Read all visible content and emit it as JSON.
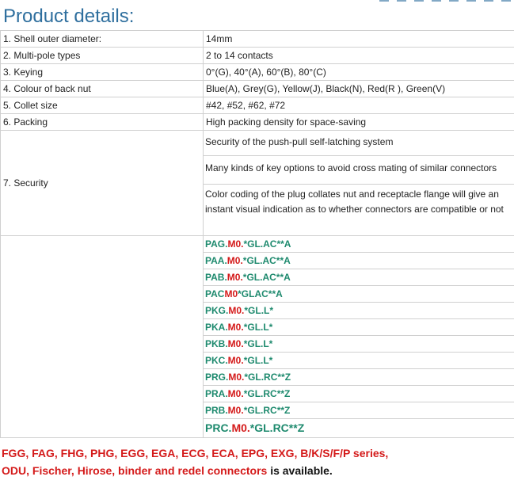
{
  "heading": "Product details:",
  "specs": [
    {
      "label": "1. Shell outer diameter:",
      "value": "14mm"
    },
    {
      "label": "2. Multi-pole types",
      "value": "2 to 14 contacts"
    },
    {
      "label": "3. Keying",
      "value": "0°(G), 40°(A), 60°(B), 80°(C)"
    },
    {
      "label": "4. Colour of back nut",
      "value": "Blue(A), Grey(G), Yellow(J), Black(N), Red(R ), Green(V)"
    },
    {
      "label": "5. Collet size",
      "value": "#42, #52, #62, #72"
    },
    {
      "label": "6. Packing",
      "value": "High packing density for space-saving"
    }
  ],
  "security": {
    "label": "7. Security",
    "items": [
      "Security of the push-pull self-latching system",
      "Many kinds of key options to avoid cross mating of similar connectors",
      "Color coding of the plug collates nut and receptacle flange will give an instant visual indication as to whether connectors are compatible or not"
    ]
  },
  "models": [
    {
      "prefix": "PAG.",
      "mid": "M0.",
      "suffix": "*GL.AC**A"
    },
    {
      "prefix": "PAA.",
      "mid": "M0.",
      "suffix": "*GL.AC**A"
    },
    {
      "prefix": "PAB.",
      "mid": "M0.",
      "suffix": "*GL.AC**A"
    },
    {
      "prefix": "PAC",
      "mid": "M0",
      "suffix": "*GLAC**A"
    },
    {
      "prefix": "PKG.",
      "mid": "M0.",
      "suffix": "*GL.L*"
    },
    {
      "prefix": "PKA.",
      "mid": "M0.",
      "suffix": "*GL.L*"
    },
    {
      "prefix": "PKB.",
      "mid": "M0.",
      "suffix": "*GL.L*"
    },
    {
      "prefix": "PKC.",
      "mid": "M0.",
      "suffix": "*GL.L*"
    },
    {
      "prefix": "PRG.",
      "mid": "M0.",
      "suffix": "*GL.RC**Z"
    },
    {
      "prefix": "PRA.",
      "mid": "M0.",
      "suffix": "*GL.RC**Z"
    },
    {
      "prefix": "PRB.",
      "mid": "M0.",
      "suffix": "*GL.RC**Z"
    },
    {
      "prefix": "PRC.",
      "mid": "M0.",
      "suffix": "*GL.RC**Z"
    }
  ],
  "footer": {
    "line1": "FGG, FAG, FHG, PHG, EGG, EGA, ECG, ECA, EPG, EXG, B/K/S/F/P series,",
    "line2_red": "ODU, Fischer, Hirose, binder and redel connectors",
    "line2_black": " is available."
  },
  "colors": {
    "heading": "#2f6f9e",
    "model_green": "#1e8a6e",
    "model_red": "#d41a1a",
    "footer_red": "#d41a1a",
    "border": "#d0d0d0"
  }
}
